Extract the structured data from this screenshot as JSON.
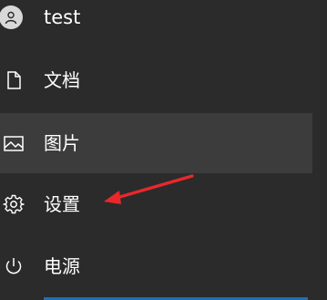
{
  "menu": {
    "user": {
      "label": "test",
      "icon": "user-avatar-icon"
    },
    "items": [
      {
        "id": "docs",
        "label": "文档",
        "icon": "document-icon"
      },
      {
        "id": "pics",
        "label": "图片",
        "icon": "picture-icon",
        "highlighted": true
      },
      {
        "id": "settings",
        "label": "设置",
        "icon": "gear-icon"
      },
      {
        "id": "power",
        "label": "电源",
        "icon": "power-icon"
      }
    ]
  },
  "colors": {
    "background": "#2b2b2b",
    "hover": "#3c3c3c",
    "text": "#ffffff",
    "annotation_arrow": "#e8282b",
    "accent": "#1e6fb8"
  },
  "annotation": {
    "points_to": "settings"
  }
}
